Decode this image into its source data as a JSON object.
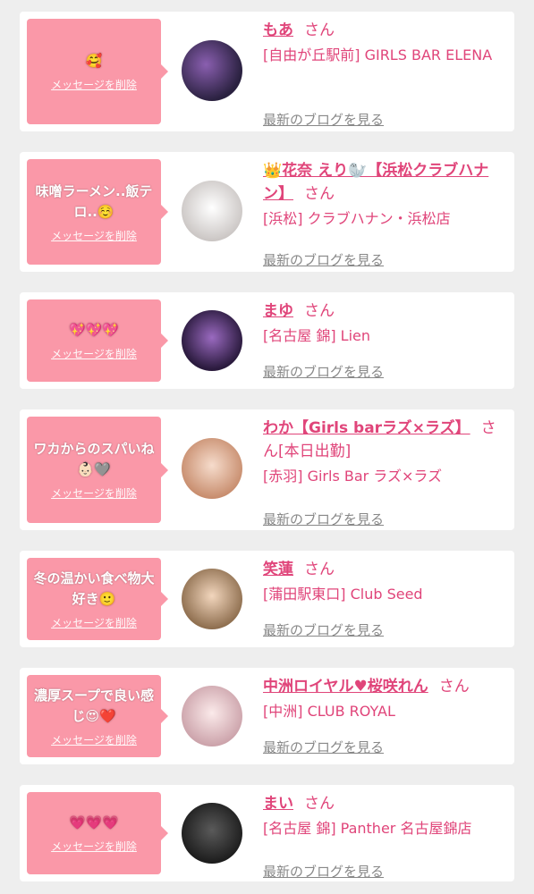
{
  "items": [
    {
      "message": "🥰",
      "delete_label": "メッセージを削除",
      "name": "もあ",
      "honorific": "さん",
      "store": "[自由が丘駅前] GIRLS BAR ELENA",
      "blog_link": "最新のブログを見る",
      "avatar_colors": [
        "#2a2140",
        "#8a5fb0"
      ]
    },
    {
      "message": "味噌ラーメン..飯テロ..☺️",
      "delete_label": "メッセージを削除",
      "name": "👑花奈 えり🦭【浜松クラブハナン】",
      "honorific": "さん",
      "store": "[浜松] クラブハナン・浜松店",
      "blog_link": "最新のブログを見る",
      "avatar_colors": [
        "#f2f2f2",
        "#c9c4c2"
      ]
    },
    {
      "message": "💖💖💖",
      "delete_label": "メッセージを削除",
      "name": "まゆ",
      "honorific": "さん",
      "store": "[名古屋 錦] Lien",
      "blog_link": "最新のブログを見る",
      "avatar_colors": [
        "#2a1a3d",
        "#7a4aa8"
      ]
    },
    {
      "message": "ワカからのスパいね👶🏻🩶",
      "delete_label": "メッセージを削除",
      "name": "わか【Girls barラズ×ラズ】",
      "honorific": "さん[本日出勤]",
      "store": "[赤羽] Girls Bar ラズ×ラズ",
      "blog_link": "最新のブログを見る",
      "avatar_colors": [
        "#f0c7b5",
        "#c68a6a"
      ]
    },
    {
      "message": "冬の温かい食べ物大好き🙂",
      "delete_label": "メッセージを削除",
      "name": "笑蓮",
      "honorific": "さん",
      "store": "[蒲田駅東口] Club Seed",
      "blog_link": "最新のブログを見る",
      "avatar_colors": [
        "#e8c5a8",
        "#8a6a4a"
      ]
    },
    {
      "message": "濃厚スープで良い感じ😍❤️",
      "delete_label": "メッセージを削除",
      "name": "中洲ロイヤル♥桜咲れん",
      "honorific": "さん",
      "store": "[中洲] CLUB ROYAL",
      "blog_link": "最新のブログを見る",
      "avatar_colors": [
        "#f6dede",
        "#caa0a8"
      ]
    },
    {
      "message": "💗💗💗",
      "delete_label": "メッセージを削除",
      "name": "まい",
      "honorific": "さん",
      "store": "[名古屋 錦] Panther 名古屋錦店",
      "blog_link": "最新のブログを見る",
      "avatar_colors": [
        "#1a1a1a",
        "#5a5a5a"
      ]
    }
  ]
}
